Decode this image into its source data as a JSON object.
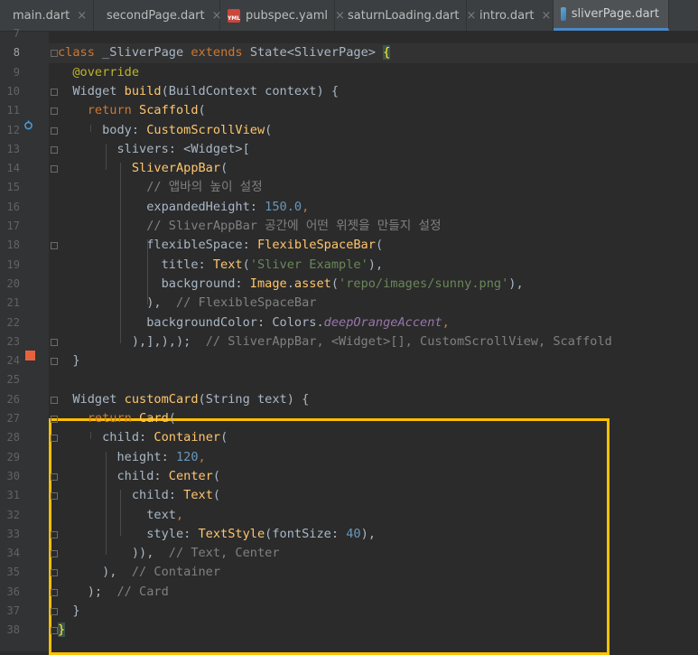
{
  "tabs": [
    {
      "label": "main.dart",
      "icon": "dart-file-icon",
      "active": false
    },
    {
      "label": "secondPage.dart",
      "icon": "dart-file-icon",
      "active": false
    },
    {
      "label": "pubspec.yaml",
      "icon": "yaml-file-icon",
      "active": false
    },
    {
      "label": "saturnLoading.dart",
      "icon": "dart-file-icon",
      "active": false
    },
    {
      "label": "intro.dart",
      "icon": "dart-file-icon",
      "active": false
    },
    {
      "label": "sliverPage.dart",
      "icon": "dart-file-icon",
      "active": true
    }
  ],
  "tab_close_glyph": "×",
  "yaml_icon_text": "YML",
  "line_numbers": [
    "7",
    "8",
    "9",
    "10",
    "11",
    "12",
    "13",
    "14",
    "15",
    "16",
    "17",
    "18",
    "19",
    "20",
    "21",
    "22",
    "23",
    "24",
    "25",
    "26",
    "27",
    "28",
    "29",
    "30",
    "31",
    "32",
    "33",
    "34",
    "35",
    "36",
    "37",
    "38"
  ],
  "current_line": "8",
  "code_lines": [
    [],
    [
      [
        "kw",
        "class "
      ],
      [
        "t",
        "_SliverPage "
      ],
      [
        "kw",
        "extends "
      ],
      [
        "t",
        "State<SliverPage> "
      ],
      [
        "brk",
        "{"
      ]
    ],
    [
      [
        "t",
        "  "
      ],
      [
        "ann",
        "@override"
      ]
    ],
    [
      [
        "t",
        "  Widget "
      ],
      [
        "cls",
        "build"
      ],
      [
        "t",
        "(BuildContext context) {"
      ]
    ],
    [
      [
        "t",
        "    "
      ],
      [
        "kw",
        "return "
      ],
      [
        "cls",
        "Scaffold"
      ],
      [
        "t",
        "("
      ]
    ],
    [
      [
        "t",
        "      body: "
      ],
      [
        "cls",
        "CustomScrollView"
      ],
      [
        "t",
        "("
      ]
    ],
    [
      [
        "t",
        "        slivers: <Widget>["
      ]
    ],
    [
      [
        "t",
        "          "
      ],
      [
        "cls",
        "SliverAppBar"
      ],
      [
        "t",
        "("
      ]
    ],
    [
      [
        "t",
        "            "
      ],
      [
        "cmt",
        "// 앱바의 높이 설정"
      ]
    ],
    [
      [
        "t",
        "            expandedHeight: "
      ],
      [
        "num",
        "150.0"
      ],
      [
        "kw",
        ","
      ]
    ],
    [
      [
        "t",
        "            "
      ],
      [
        "cmt",
        "// SliverAppBar 공간에 어떤 위젯을 만들지 설정"
      ]
    ],
    [
      [
        "t",
        "            flexibleSpace: "
      ],
      [
        "cls",
        "FlexibleSpaceBar"
      ],
      [
        "t",
        "("
      ]
    ],
    [
      [
        "t",
        "              title: "
      ],
      [
        "cls",
        "Text"
      ],
      [
        "t",
        "("
      ],
      [
        "str",
        "'Sliver Example'"
      ],
      [
        "t",
        "),"
      ]
    ],
    [
      [
        "t",
        "              background: "
      ],
      [
        "cls",
        "Image"
      ],
      [
        "t",
        "."
      ],
      [
        "cls",
        "asset"
      ],
      [
        "t",
        "("
      ],
      [
        "str",
        "'repo/images/sunny.png'"
      ],
      [
        "t",
        "),"
      ]
    ],
    [
      [
        "t",
        "            ),  "
      ],
      [
        "cmt",
        "// FlexibleSpaceBar"
      ]
    ],
    [
      [
        "t",
        "            backgroundColor: Colors."
      ],
      [
        "prop",
        "deepOrangeAccent"
      ],
      [
        "kw",
        ","
      ]
    ],
    [
      [
        "t",
        "          ),],),);  "
      ],
      [
        "cmt",
        "// SliverAppBar, <Widget>[], CustomScrollView, Scaffold"
      ]
    ],
    [
      [
        "t",
        "  }"
      ]
    ],
    [],
    [
      [
        "t",
        "  Widget "
      ],
      [
        "cls",
        "customCard"
      ],
      [
        "t",
        "(String text) {"
      ]
    ],
    [
      [
        "t",
        "    "
      ],
      [
        "kw",
        "return "
      ],
      [
        "cls",
        "Card"
      ],
      [
        "t",
        "("
      ]
    ],
    [
      [
        "t",
        "      child: "
      ],
      [
        "cls",
        "Container"
      ],
      [
        "t",
        "("
      ]
    ],
    [
      [
        "t",
        "        height: "
      ],
      [
        "num",
        "120"
      ],
      [
        "kw",
        ","
      ]
    ],
    [
      [
        "t",
        "        child: "
      ],
      [
        "cls",
        "Center"
      ],
      [
        "t",
        "("
      ]
    ],
    [
      [
        "t",
        "          child: "
      ],
      [
        "cls",
        "Text"
      ],
      [
        "t",
        "("
      ]
    ],
    [
      [
        "t",
        "            text"
      ],
      [
        "kw",
        ","
      ]
    ],
    [
      [
        "t",
        "            style: "
      ],
      [
        "cls",
        "TextStyle"
      ],
      [
        "t",
        "(fontSize: "
      ],
      [
        "num",
        "40"
      ],
      [
        "t",
        "),"
      ]
    ],
    [
      [
        "t",
        "          )),  "
      ],
      [
        "cmt",
        "// Text, Center"
      ]
    ],
    [
      [
        "t",
        "      ),  "
      ],
      [
        "cmt",
        "// Container"
      ]
    ],
    [
      [
        "t",
        "    );  "
      ],
      [
        "cmt",
        "// Card"
      ]
    ],
    [
      [
        "t",
        "  }"
      ]
    ],
    [
      [
        "brk",
        "}"
      ]
    ]
  ],
  "icons": {
    "override_marker": "override-gutter-icon",
    "bookmark_marker": "color-swatch-gutter-icon"
  },
  "colors": {
    "bookmark": "#e8613f",
    "highlight_box": "#ffc000",
    "active_tab_underline": "#4a88c7",
    "editor_bg": "#2b2b2b"
  }
}
